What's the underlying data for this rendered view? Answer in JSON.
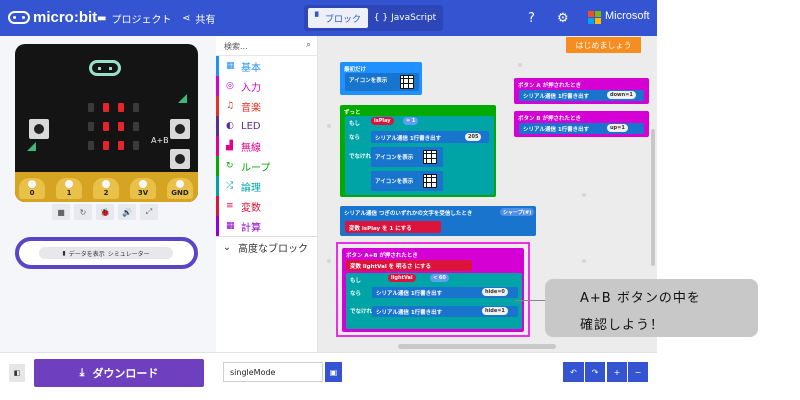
{
  "header": {
    "logo_text": "micro:bit",
    "projects_label": "プロジェクト",
    "share_label": "共有",
    "blocks_tab_label": "ブロック",
    "javascript_tab_label": "JavaScript",
    "microsoft_label": "Microsoft",
    "help_icon": "?",
    "settings_icon": "⚙"
  },
  "simulator": {
    "ab_label": "A+B",
    "button_a_label": "A",
    "button_b_label": "B",
    "pins": [
      "0",
      "1",
      "2",
      "3V",
      "GND"
    ],
    "show_data_label": "データを表示",
    "show_data_sub": "シミュレーター",
    "controls": [
      "■",
      "↻",
      "🐞",
      "🔊",
      "⤢"
    ]
  },
  "toolbox": {
    "search_placeholder": "検索...",
    "categories": [
      {
        "label": "基本",
        "color": "#1e90ff",
        "icon": "▦"
      },
      {
        "label": "入力",
        "color": "#d400d4",
        "icon": "◎"
      },
      {
        "label": "音楽",
        "color": "#e63022",
        "icon": "♫"
      },
      {
        "label": "LED",
        "color": "#5c2d91",
        "icon": "◐"
      },
      {
        "label": "無線",
        "color": "#e3008c",
        "icon": "▟"
      },
      {
        "label": "ループ",
        "color": "#00aa00",
        "icon": "↻"
      },
      {
        "label": "論理",
        "color": "#00a4a6",
        "icon": "⤮"
      },
      {
        "label": "変数",
        "color": "#dc143c",
        "icon": "≡"
      },
      {
        "label": "計算",
        "color": "#9400d3",
        "icon": "▦"
      }
    ],
    "advanced_label": "高度なブロック"
  },
  "workspace": {
    "tutorial_button": "はじめましょう",
    "blocks": {
      "on_start": "最初だけ",
      "show_icon": "アイコンを表示",
      "forever": "ずっと",
      "if_label": "もし",
      "then_label": "なら",
      "else_label": "でなければ",
      "serial_write_label": "シリアル通信 1行書き出す",
      "serial_205": "205",
      "var_isplay": "isPlay",
      "eq_one": "= 1",
      "on_button_a": "ボタン A が押されたとき",
      "on_button_b": "ボタン B が押されたとき",
      "down_value": "down=1",
      "up_value": "up=1",
      "on_serial": "シリアル通信 つぎのいずれかの文字を受信したとき",
      "sharp_option": "シャープ(#)",
      "set_var": "変数 isPlay を 1 にする",
      "on_button_ab": "ボタン A+B が押されたとき",
      "set_lightval": "変数 lightVal を 明るさ にする",
      "lightval": "lightVal",
      "lt_60": "< 60",
      "hide_0": "hide=0",
      "hide_1": "hide=1"
    }
  },
  "bottombar": {
    "download_label": "ダウンロード",
    "project_name": "singleMode",
    "undo_icon": "↶",
    "redo_icon": "↷",
    "zoom_in_icon": "+",
    "zoom_out_icon": "−"
  },
  "callout": {
    "line1": "A+B ボタンの中を",
    "line2": "確認しよう！"
  }
}
